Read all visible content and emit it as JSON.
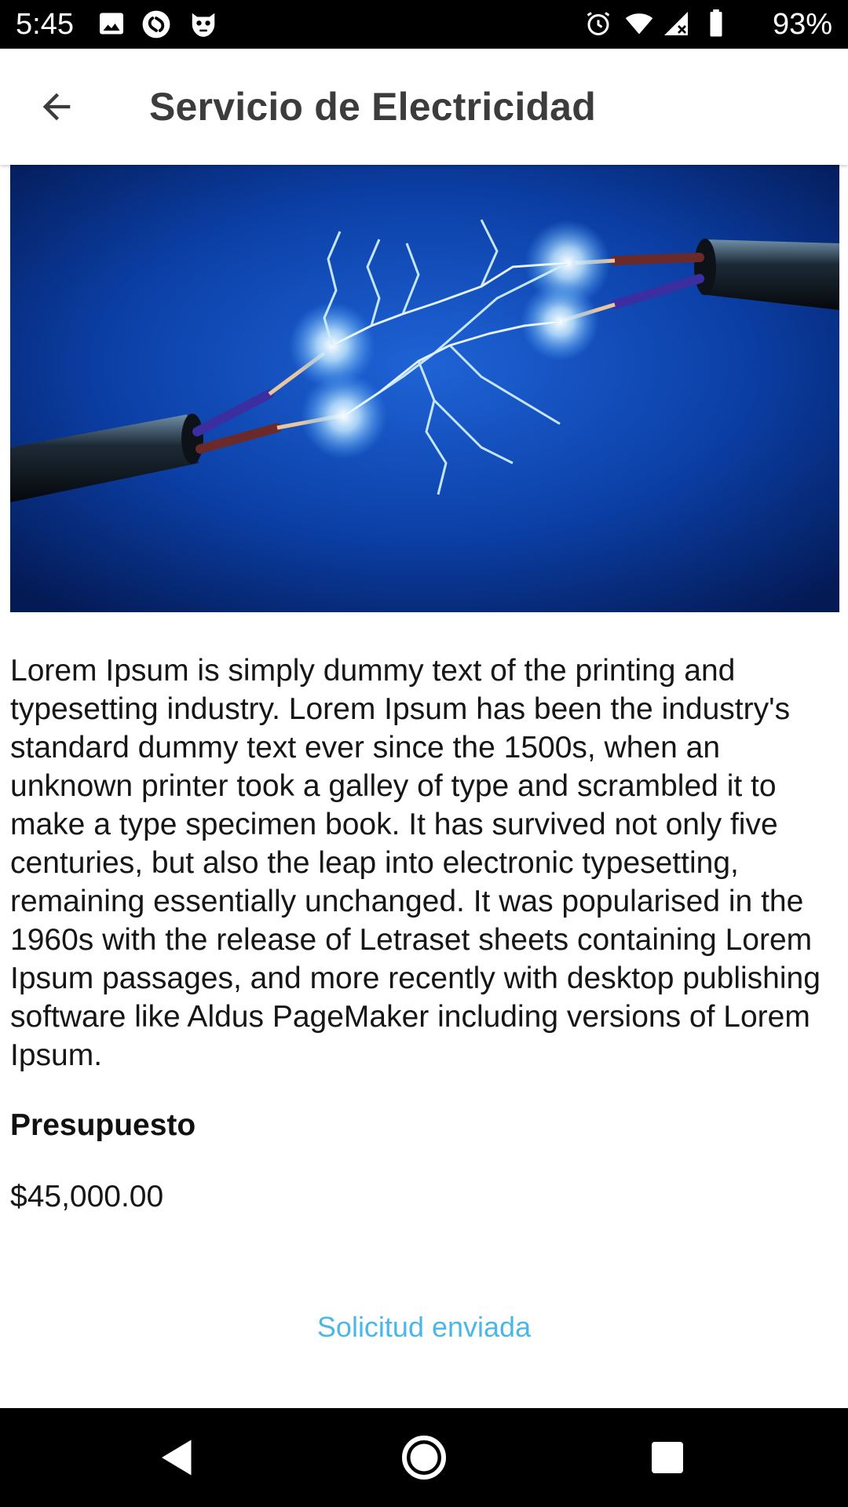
{
  "status_bar": {
    "time": "5:45",
    "battery_percent": "93%",
    "left_icons": [
      "image-icon",
      "shazam-icon",
      "mask-icon"
    ],
    "right_icons": [
      "alarm-icon",
      "wifi-icon",
      "signal-icon",
      "battery-icon"
    ]
  },
  "app_bar": {
    "title": "Servicio de Electricidad",
    "back_icon": "arrow-back-icon"
  },
  "service": {
    "image_subject": "electric-sparks-wires",
    "description": "Lorem Ipsum is simply dummy text of the printing and typesetting industry. Lorem Ipsum has been the industry's standard dummy text ever since the 1500s, when an unknown printer took a galley of type and scrambled it to make a type specimen book. It has survived not only five centuries, but also the leap into electronic typesetting, remaining essentially unchanged. It was popularised in the 1960s with the release of Letraset sheets containing Lorem Ipsum passages, and more recently with desktop publishing software like Aldus PageMaker including versions of Lorem Ipsum.",
    "budget_label": "Presupuesto",
    "budget_value": "$45,000.00",
    "request_status": "Solicitud enviada"
  },
  "colors": {
    "accent_link": "#4bb7e8",
    "title_text": "#3c3c3c",
    "image_background": "#0a3a9c"
  },
  "nav_bar": {
    "buttons": [
      "back-triangle-icon",
      "home-circle-icon",
      "recents-square-icon"
    ]
  }
}
